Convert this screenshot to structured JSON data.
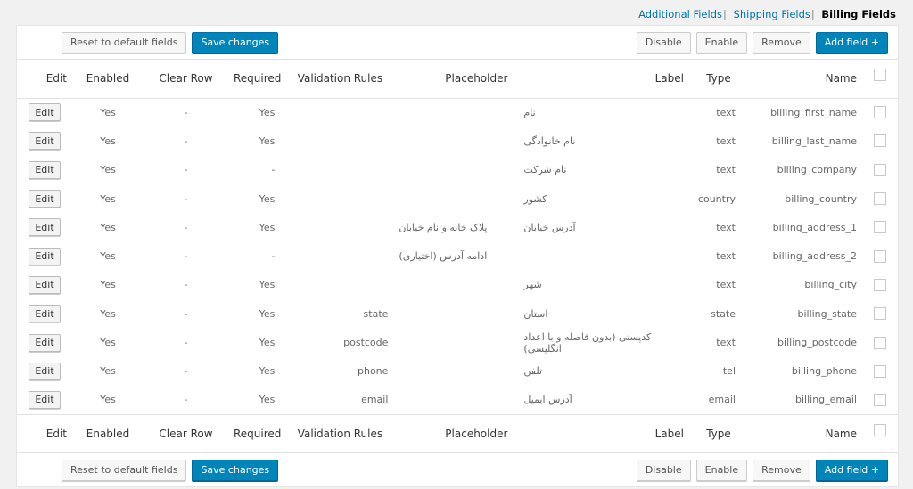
{
  "tabs": [
    {
      "label": "Additional Fields",
      "active": false
    },
    {
      "label": "Shipping Fields",
      "active": false
    },
    {
      "label": "Billing Fields",
      "active": true
    }
  ],
  "tab_separator": "|",
  "toolbar": {
    "reset_label": "Reset to default fields",
    "save_label": "Save changes",
    "disable_label": "Disable",
    "enable_label": "Enable",
    "remove_label": "Remove",
    "add_field_label": "Add field +"
  },
  "colors": {
    "primary": "#0085ba",
    "link": "#0073aa"
  },
  "table": {
    "columns": [
      "Edit",
      "Enabled",
      "Clear Row",
      "Required",
      "Validation Rules",
      "Placeholder",
      "Label",
      "Type",
      "Name"
    ],
    "edit_button_label": "Edit",
    "rows": [
      {
        "enabled": "Yes",
        "clear_row": "-",
        "required": "Yes",
        "validation": "",
        "placeholder": "",
        "label": "نام",
        "type": "text",
        "name": "billing_first_name"
      },
      {
        "enabled": "Yes",
        "clear_row": "-",
        "required": "Yes",
        "validation": "",
        "placeholder": "",
        "label": "نام خانوادگی",
        "type": "text",
        "name": "billing_last_name"
      },
      {
        "enabled": "Yes",
        "clear_row": "-",
        "required": "-",
        "validation": "",
        "placeholder": "",
        "label": "نام شرکت",
        "type": "text",
        "name": "billing_company"
      },
      {
        "enabled": "Yes",
        "clear_row": "-",
        "required": "Yes",
        "validation": "",
        "placeholder": "",
        "label": "کشور",
        "type": "country",
        "name": "billing_country"
      },
      {
        "enabled": "Yes",
        "clear_row": "-",
        "required": "Yes",
        "validation": "",
        "placeholder": "پلاک خانه و نام خیابان",
        "label": "آدرس خیابان",
        "type": "text",
        "name": "billing_address_1"
      },
      {
        "enabled": "Yes",
        "clear_row": "-",
        "required": "-",
        "validation": "",
        "placeholder": "ادامه آدرس (اختیاری)",
        "label": "",
        "type": "text",
        "name": "billing_address_2"
      },
      {
        "enabled": "Yes",
        "clear_row": "-",
        "required": "Yes",
        "validation": "",
        "placeholder": "",
        "label": "شهر",
        "type": "text",
        "name": "billing_city"
      },
      {
        "enabled": "Yes",
        "clear_row": "-",
        "required": "Yes",
        "validation": "state",
        "placeholder": "",
        "label": "استان",
        "type": "state",
        "name": "billing_state"
      },
      {
        "enabled": "Yes",
        "clear_row": "-",
        "required": "Yes",
        "validation": "postcode",
        "placeholder": "",
        "label": "کدپستی (بدون فاصله و با اعداد انگلیسی)",
        "type": "text",
        "name": "billing_postcode"
      },
      {
        "enabled": "Yes",
        "clear_row": "-",
        "required": "Yes",
        "validation": "phone",
        "placeholder": "",
        "label": "تلفن",
        "type": "tel",
        "name": "billing_phone"
      },
      {
        "enabled": "Yes",
        "clear_row": "-",
        "required": "Yes",
        "validation": "email",
        "placeholder": "",
        "label": "آدرس ایمیل",
        "type": "email",
        "name": "billing_email"
      }
    ]
  }
}
